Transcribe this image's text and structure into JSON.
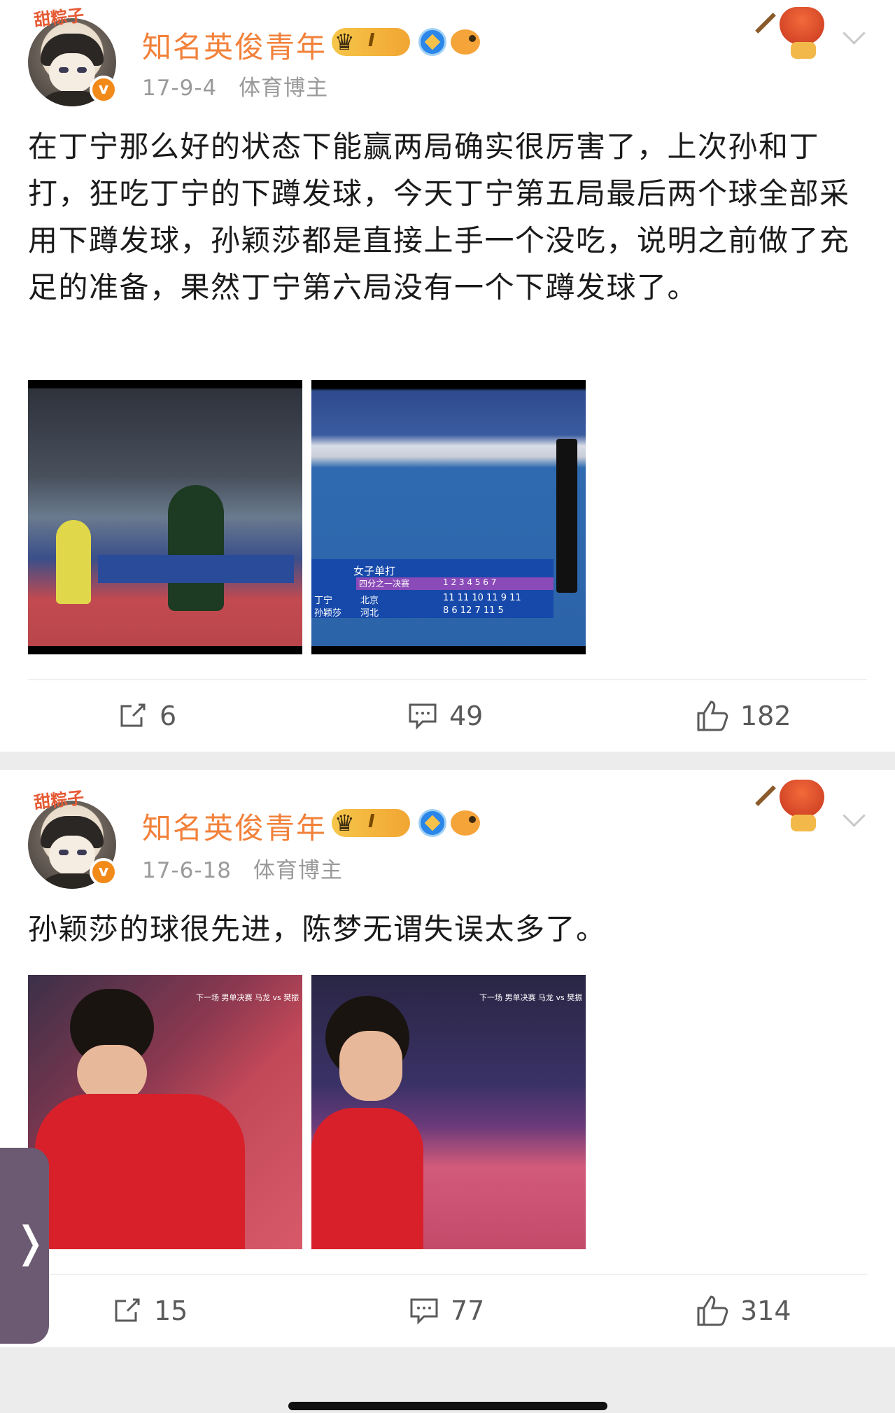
{
  "posts": [
    {
      "author": "知名英俊青年",
      "avatar_tag": "甜粽子",
      "vip_level": "I",
      "verified_mark": "v",
      "date": "17-9-4",
      "role": "体育博主",
      "text": "在丁宁那么好的状态下能赢两局确实很厉害了，上次孙和丁打，狂吃丁宁的下蹲发球，今天丁宁第五局最后两个球全部采用下蹲发球，孙颖莎都是直接上手一个没吃，说明之前做了充足的准备，果然丁宁第六局没有一个下蹲发球了。",
      "images": [
        {
          "alt": "table-tennis-match-photo"
        },
        {
          "alt": "scoreboard-photo",
          "scoreboard": {
            "title": "女子单打",
            "round": "四分之一决赛",
            "games": "1  2  3  4  5  6  7",
            "p1_name": "丁宁",
            "p1_team": "北京",
            "p1_scores": "11  11  10  11  9  11",
            "p2_name": "孙颖莎",
            "p2_team": "河北",
            "p2_scores": "8  6  12  7  11  5"
          }
        }
      ],
      "reposts": "6",
      "comments": "49",
      "likes": "182"
    },
    {
      "author": "知名英俊青年",
      "avatar_tag": "甜粽子",
      "vip_level": "I",
      "verified_mark": "v",
      "date": "17-6-18",
      "role": "体育博主",
      "text": "孙颖莎的球很先进，陈梦无谓失误太多了。",
      "images": [
        {
          "alt": "sun-yingsha-photo-1",
          "overlay": "下一场 男单决赛 马龙 vs 樊振"
        },
        {
          "alt": "sun-yingsha-photo-2",
          "overlay": "下一场 男单决赛 马龙 vs 樊振"
        }
      ],
      "reposts": "15",
      "comments": "77",
      "likes": "314"
    }
  ],
  "colors": {
    "username": "#f2813a",
    "meta": "#9a9a9a",
    "text": "#1a1a1a",
    "separator": "#ececec"
  },
  "icons": {
    "more": "chevron-down-icon",
    "repost": "repost-icon",
    "comment": "comment-icon",
    "like": "like-icon",
    "side": "chevron-right-icon"
  },
  "side_tab_glyph": "❭"
}
